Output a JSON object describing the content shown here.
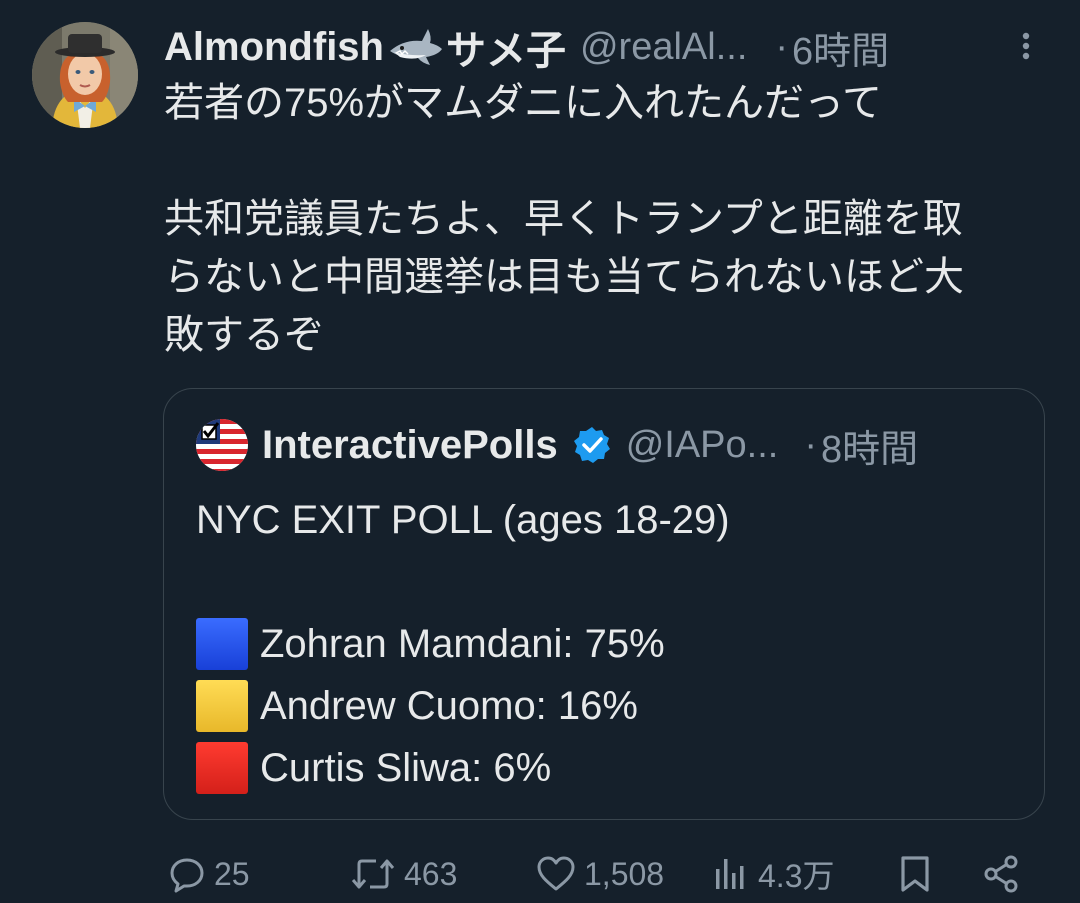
{
  "tweet": {
    "author_name": "Almondfish",
    "author_name_suffix": "サメ子",
    "handle": "@realAl...",
    "dot": "·",
    "time": "6時間",
    "text_lines": [
      "若者の75%がマムダニに入れたんだって",
      "",
      "共和党議員たちよ、早くトランプと距離を取",
      "らないと中間選挙は目も当てられないほど大",
      "敗するぞ"
    ]
  },
  "quote": {
    "author_name": "InteractivePolls",
    "handle": "@IAPo...",
    "dot": "·",
    "time": "8時間",
    "lines": [
      "NYC EXIT POLL  (ages 18-29)",
      "",
      "Zohran Mamdani: 75%",
      "Andrew Cuomo: 16%",
      "Curtis Sliwa: 6%"
    ],
    "square_colors": [
      "#1d4ff0",
      "#f5c83a",
      "#e8281f"
    ]
  },
  "actions": {
    "replies": "25",
    "retweets": "463",
    "likes": "1,508",
    "views": "4.3万"
  },
  "colors": {
    "background": "#15202b",
    "text": "#e7e9ea",
    "secondary": "#8b98a5",
    "verified": "#1d9bf0",
    "border": "#38444d"
  },
  "icons": [
    "more-icon",
    "shark-emoji",
    "verified-badge-icon",
    "reply-icon",
    "retweet-icon",
    "like-icon",
    "views-icon",
    "bookmark-icon",
    "share-icon"
  ]
}
